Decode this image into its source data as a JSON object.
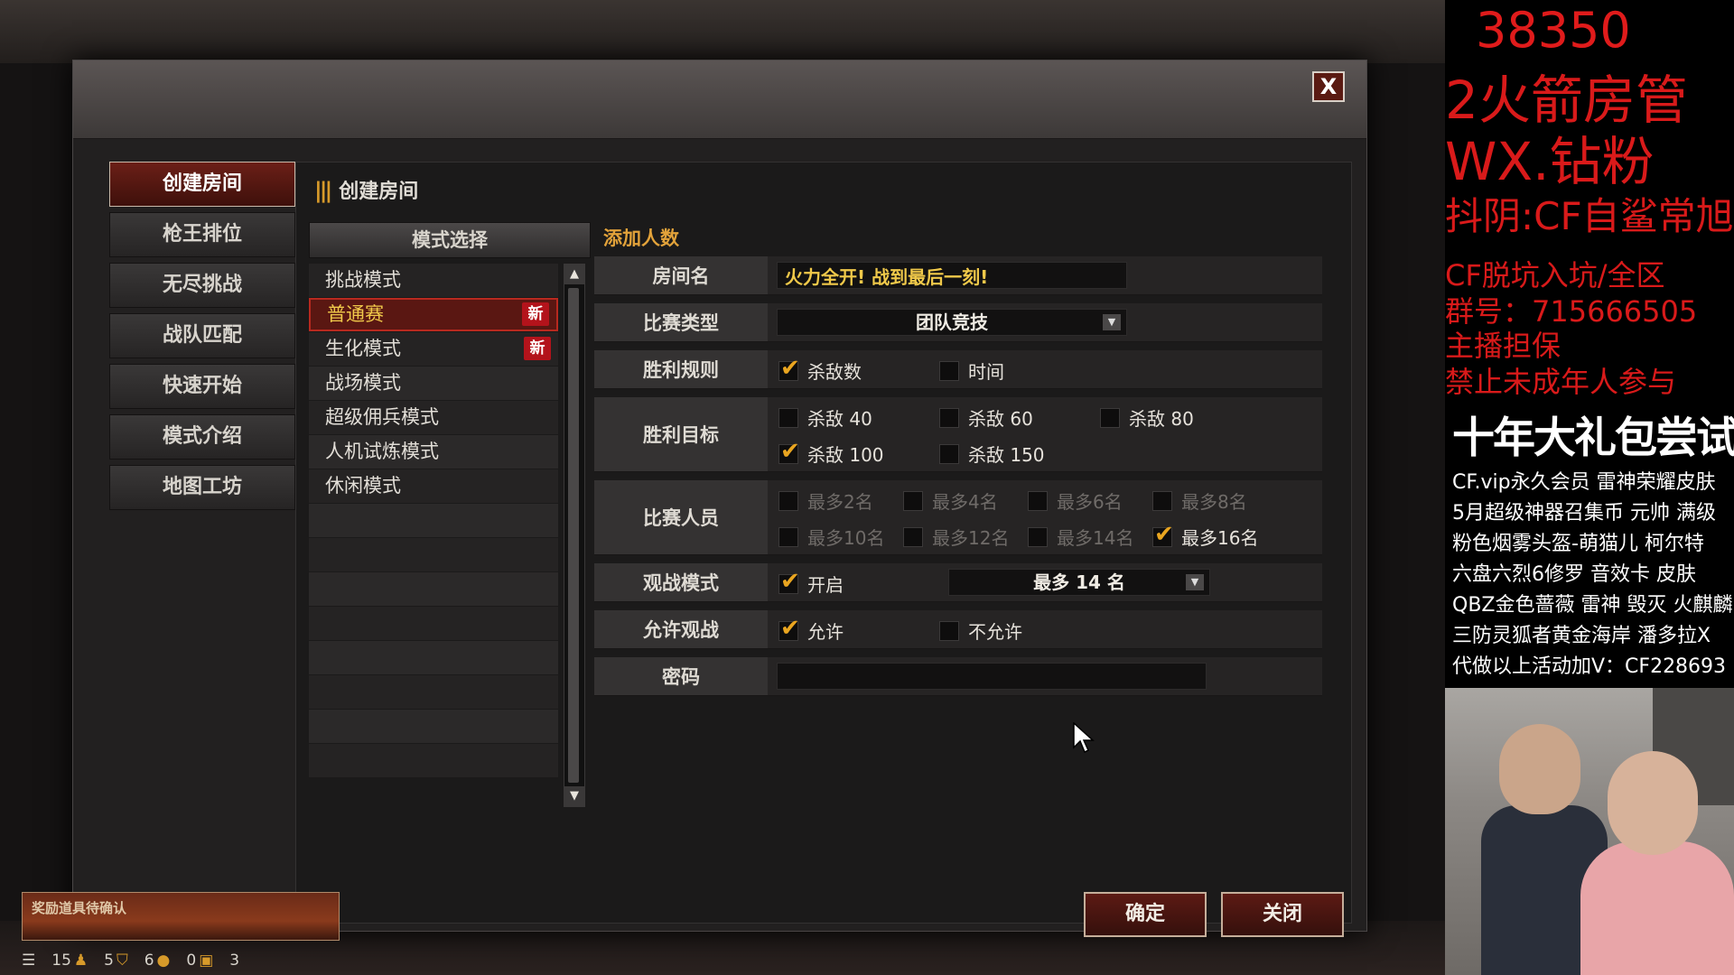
{
  "dialog": {
    "close_label": "X",
    "nav": [
      {
        "label": "创建房间",
        "active": true
      },
      {
        "label": "枪王排位"
      },
      {
        "label": "无尽挑战"
      },
      {
        "label": "战队匹配"
      },
      {
        "label": "快速开始"
      },
      {
        "label": "模式介绍"
      },
      {
        "label": "地图工坊"
      }
    ],
    "content_title": "创建房间",
    "mode_select_header": "模式选择",
    "modes": [
      {
        "label": "挑战模式"
      },
      {
        "label": "普通赛",
        "badge": "新",
        "selected": true
      },
      {
        "label": "生化模式",
        "badge": "新"
      },
      {
        "label": "战场模式"
      },
      {
        "label": "超级佣兵模式"
      },
      {
        "label": "人机试炼模式"
      },
      {
        "label": "休闲模式"
      }
    ],
    "settings_title": "添加人数",
    "fields": {
      "room_name_label": "房间名",
      "room_name_value": "火力全开! 战到最后一刻!",
      "match_type_label": "比赛类型",
      "match_type_value": "团队竞技",
      "win_rule_label": "胜利规则",
      "win_rule_kills": "杀敌数",
      "win_rule_time": "时间",
      "win_target_label": "胜利目标",
      "targets": [
        "杀敌 40",
        "杀敌 60",
        "杀敌 80",
        "杀敌 100",
        "杀敌 150"
      ],
      "players_label": "比赛人员",
      "player_options": [
        "最多2名",
        "最多4名",
        "最多6名",
        "最多8名",
        "最多10名",
        "最多12名",
        "最多14名",
        "最多16名"
      ],
      "spectate_label": "观战模式",
      "spectate_on": "开启",
      "spectate_limit": "最多 14 名",
      "allow_label": "允许观战",
      "allow_yes": "允许",
      "allow_no": "不允许",
      "password_label": "密码",
      "password_value": ""
    },
    "confirm": "确定",
    "close": "关闭"
  },
  "notice": "奖励道具待确认",
  "status": [
    "15",
    "5",
    "6",
    "0",
    "3"
  ],
  "overlay": {
    "number": "38350",
    "line1": "2火箭房管",
    "line2": "WX.钻粉",
    "line3": "抖阴:CF自鲨常旭",
    "line4": "CF脱坑入坑/全区",
    "line5": "群号：715666505",
    "line6": "主播担保",
    "line7": "禁止未成年人参与",
    "headline": "十年大礼包尝试解封",
    "list": [
      "CF.vip永久会员 雷神荣耀皮肤",
      "5月超级神器召集币 元帅 满级",
      "粉色烟雾头盔-萌猫儿 柯尔特",
      "六盘六烈6修罗 音效卡 皮肤",
      "QBZ金色蔷薇 雷神 毁灭 火麒麟",
      "三防灵狐者黄金海岸 潘多拉X",
      "代做以上活动加V：CF228693"
    ]
  },
  "colors": {
    "accent": "#e9a520",
    "red": "#b3131b",
    "gold_text": "#f0c94a"
  }
}
